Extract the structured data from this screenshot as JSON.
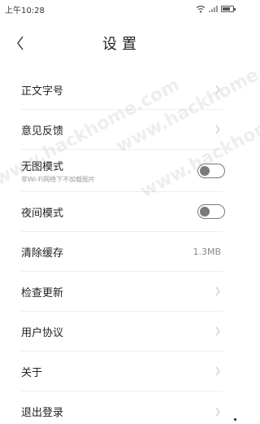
{
  "status_bar": {
    "time": "上午10:28",
    "icons": [
      "wifi-icon",
      "signal-icon",
      "battery-icon"
    ]
  },
  "header": {
    "back_icon": "chevron-left-icon",
    "title": "设置"
  },
  "settings": [
    {
      "label": "正文字号",
      "type": "nav"
    },
    {
      "label": "意见反馈",
      "type": "nav"
    },
    {
      "label": "无图模式",
      "sub": "非Wi-Fi网络下不加载图片",
      "type": "toggle",
      "enabled": false
    },
    {
      "label": "夜间模式",
      "type": "toggle",
      "enabled": false
    },
    {
      "label": "清除缓存",
      "type": "value",
      "value": "1.3MB"
    },
    {
      "label": "检查更新",
      "type": "nav"
    },
    {
      "label": "用户协议",
      "type": "nav"
    },
    {
      "label": "关于",
      "type": "nav"
    },
    {
      "label": "退出登录",
      "type": "nav"
    }
  ],
  "watermark": "www.hackhome.com",
  "colors": {
    "background": "#ffffff",
    "divider": "#eeeeee",
    "chevron": "#c8c8c8",
    "toggle_off": "#7a7a7a",
    "secondary_text": "#888888"
  }
}
